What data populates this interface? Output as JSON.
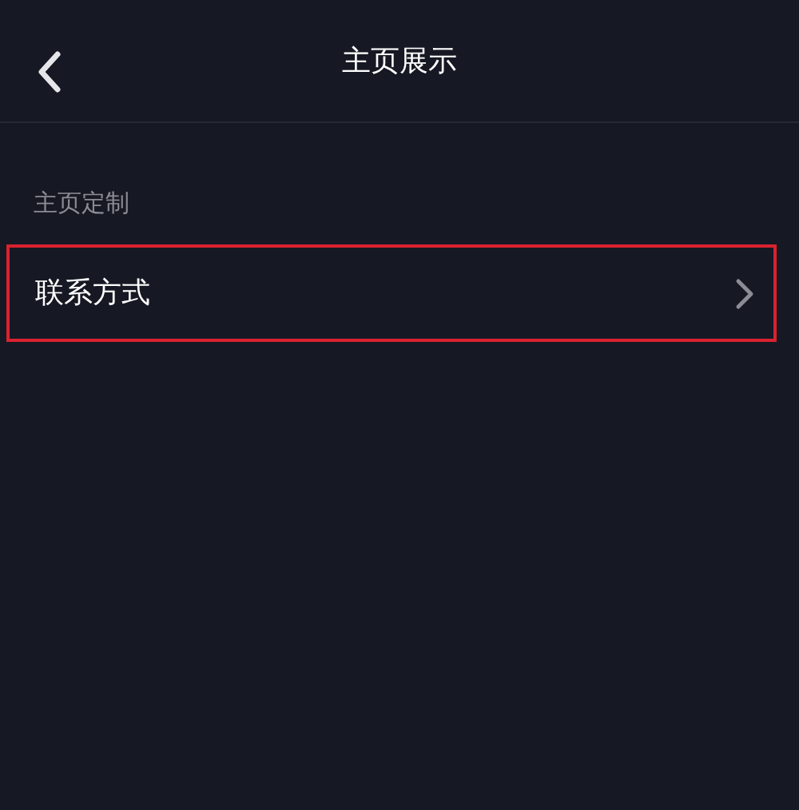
{
  "header": {
    "title": "主页展示"
  },
  "section": {
    "label": "主页定制"
  },
  "rows": [
    {
      "label": "联系方式",
      "highlighted": true
    }
  ]
}
